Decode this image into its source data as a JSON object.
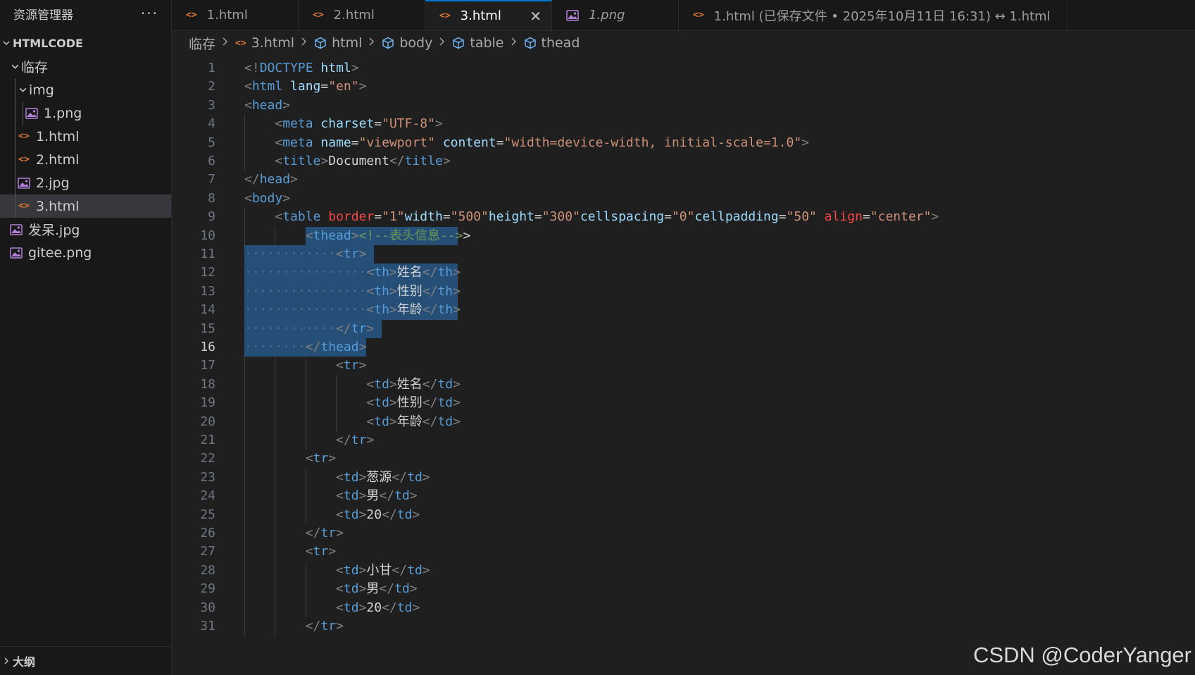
{
  "sidebar": {
    "title": "资源管理器",
    "more": "···",
    "section": "HTMLCODE",
    "tree": [
      {
        "label": "临存",
        "type": "folder",
        "depth": 0
      },
      {
        "label": "img",
        "type": "folder",
        "depth": 1
      },
      {
        "label": "1.png",
        "type": "image",
        "depth": 2
      },
      {
        "label": "1.html",
        "type": "html",
        "depth": 1
      },
      {
        "label": "2.html",
        "type": "html",
        "depth": 1
      },
      {
        "label": "2.jpg",
        "type": "image",
        "depth": 1
      },
      {
        "label": "3.html",
        "type": "html",
        "depth": 1,
        "selected": true
      },
      {
        "label": "发呆.jpg",
        "type": "image",
        "depth": 0
      },
      {
        "label": "gitee.png",
        "type": "image",
        "depth": 0
      }
    ],
    "outline": "大纲"
  },
  "tabs": [
    {
      "label": "1.html",
      "icon": "html-icon"
    },
    {
      "label": "2.html",
      "icon": "html-icon"
    },
    {
      "label": "3.html",
      "icon": "html-icon",
      "active": true,
      "close": "✕"
    },
    {
      "label": "1.png",
      "icon": "image-icon",
      "italic": true
    },
    {
      "label": "1.html (已保存文件 • 2025年10月11日 16:31) ↔ 1.html",
      "icon": "html-icon"
    }
  ],
  "breadcrumb": [
    "临存",
    "3.html",
    "html",
    "body",
    "table",
    "thead"
  ],
  "editor": {
    "current_line": 16,
    "lines": [
      "<!DOCTYPE html>",
      "<html lang=\"en\">",
      "<head>",
      "    <meta charset=\"UTF-8\">",
      "    <meta name=\"viewport\" content=\"width=device-width, initial-scale=1.0\">",
      "    <title>Document</title>",
      "</head>",
      "<body>",
      "    <table border=\"1\"width=\"500\"height=\"300\"cellspacing=\"0\"cellpadding=\"50\" align=\"center\">",
      "        <thead><!--表头信息-->>",
      "            <tr>",
      "                <th>姓名</th>",
      "                <th>性别</th>",
      "                <th>年龄</th>",
      "            </tr>",
      "        </thead>",
      "            <tr>",
      "                <td>姓名</td>",
      "                <td>性别</td>",
      "                <td>年龄</td>",
      "            </tr>",
      "        <tr>",
      "            <td>葱源</td>",
      "            <td>男</td>",
      "            <td>20</td>",
      "        </tr>",
      "        <tr>",
      "            <td>小甘</td>",
      "            <td>男</td>",
      "            <td>20</td>",
      "        </tr>"
    ]
  },
  "watermark": "CSDN @CoderYanger",
  "colors": {
    "background": "#1f1f1f",
    "sidebar": "#181818",
    "selection": "#264f78",
    "tag": "#569cd6",
    "attribute": "#9cdcfe",
    "string": "#ce9178",
    "comment": "#6a9955",
    "html_icon": "#e37933",
    "image_icon": "#b180d7",
    "accent": "#0078d4"
  }
}
